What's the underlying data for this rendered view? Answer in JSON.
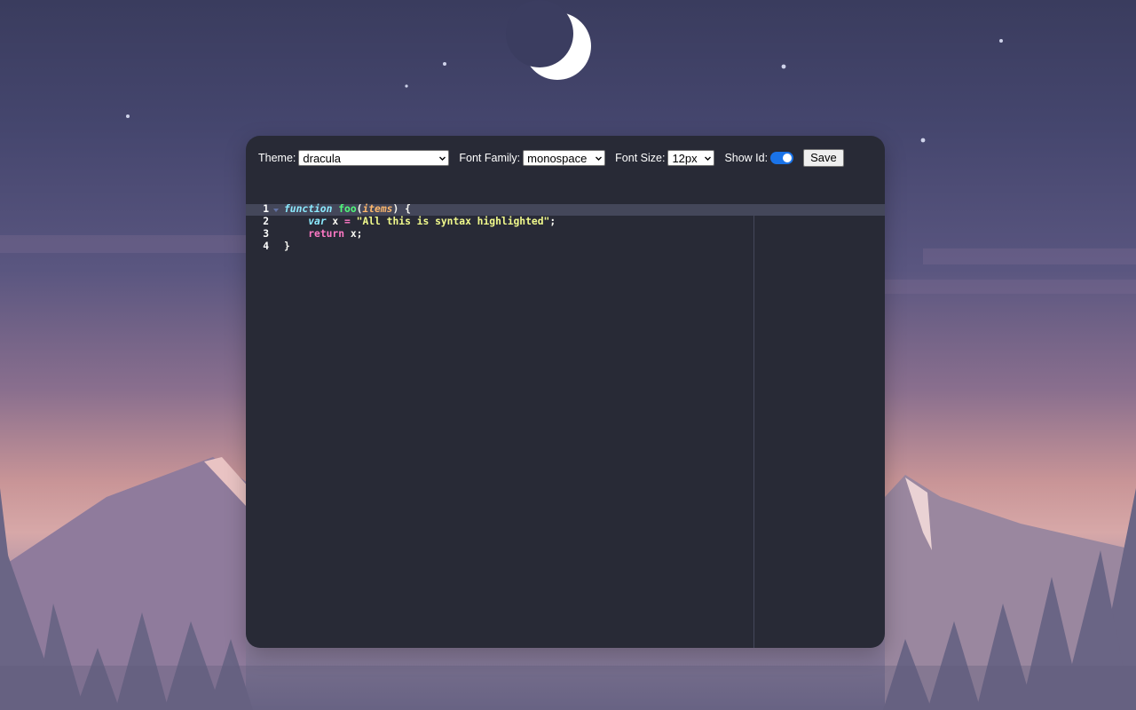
{
  "toolbar": {
    "theme_label": "Theme:",
    "theme_value": "dracula",
    "font_family_label": "Font Family:",
    "font_family_value": "monospace",
    "font_size_label": "Font Size:",
    "font_size_value": "12px",
    "show_id_label": "Show Id:",
    "show_id_on": true,
    "save_label": "Save"
  },
  "editor": {
    "line_numbers": [
      "1",
      "2",
      "3",
      "4"
    ],
    "line1": {
      "kw": "function",
      "name": "foo",
      "open": "(",
      "param": "items",
      "close": ") {"
    },
    "line2": {
      "indent": "    ",
      "kw": "var",
      "name": " x ",
      "op": "=",
      "space": " ",
      "str": "\"All this is syntax highlighted\"",
      "end": ";"
    },
    "line3": {
      "indent": "    ",
      "kw": "return",
      "rest": " x;"
    },
    "line4": {
      "text": "}"
    }
  },
  "colors": {
    "panel_bg": "#282a36",
    "active_line": "#44475a",
    "toggle_on": "#1a73e8"
  }
}
